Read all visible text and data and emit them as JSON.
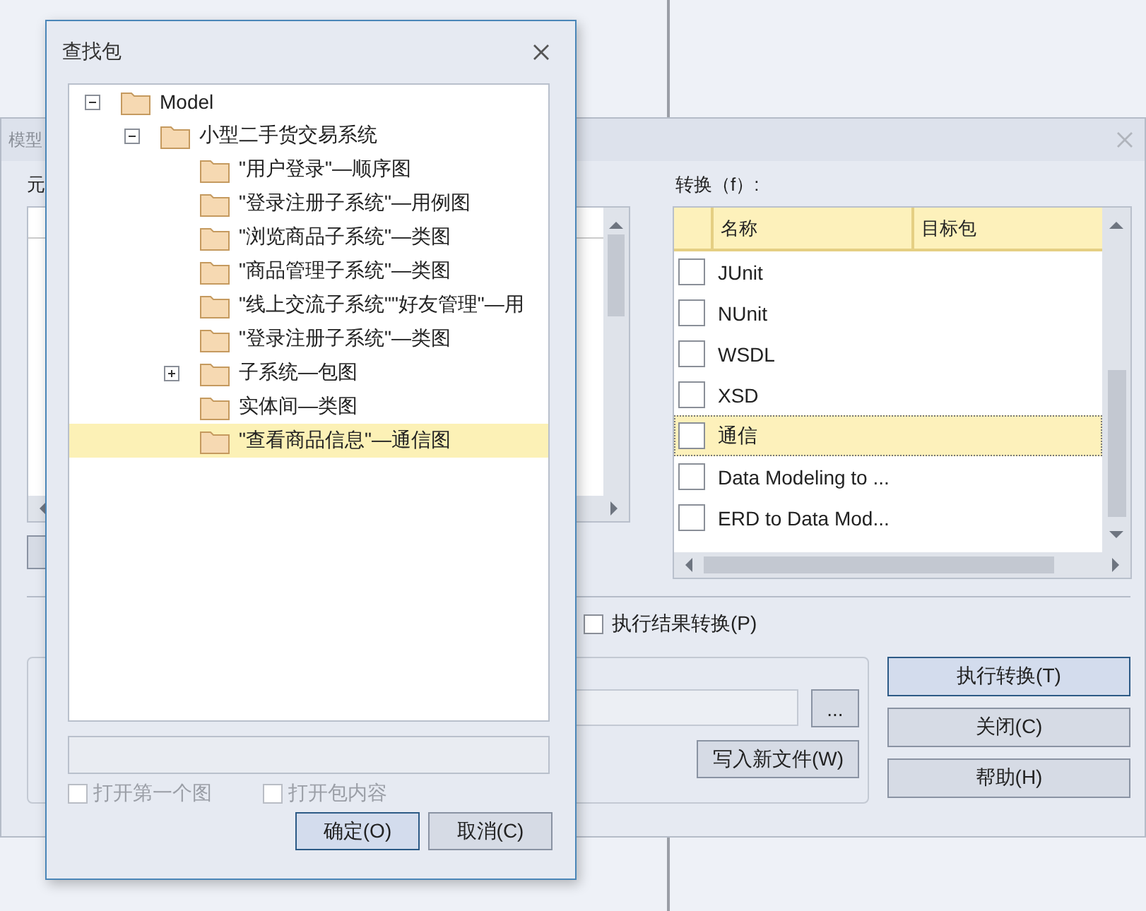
{
  "background_dialog": {
    "title": "模型",
    "element_label": "元",
    "transform_label": "转换（f）:",
    "transforms": {
      "columns": [
        "名称",
        "目标包"
      ],
      "rows": [
        {
          "name": "JUnit",
          "checked": false,
          "selected": false
        },
        {
          "name": "NUnit",
          "checked": false,
          "selected": false
        },
        {
          "name": "WSDL",
          "checked": false,
          "selected": false
        },
        {
          "name": "XSD",
          "checked": false,
          "selected": false
        },
        {
          "name": "通信",
          "checked": false,
          "selected": true
        },
        {
          "name": "Data Modeling to ...",
          "checked": false,
          "selected": false
        },
        {
          "name": "ERD to Data Mod...",
          "checked": false,
          "selected": false
        }
      ]
    },
    "execute_result_transform": {
      "label": "执行结果转换(P)",
      "checked": false
    },
    "browse_button": "...",
    "write_new_file_button": "写入新文件(W)",
    "buttons": [
      {
        "label": "执行转换(T)",
        "default": true
      },
      {
        "label": "关闭(C)",
        "default": false
      },
      {
        "label": "帮助(H)",
        "default": false
      }
    ]
  },
  "find_package_dialog": {
    "title": "查找包",
    "tree": [
      {
        "label": "Model",
        "expanded": true,
        "selected": false,
        "children": [
          {
            "label": "小型二手货交易系统",
            "expanded": true,
            "selected": false,
            "children": [
              {
                "label": "\"用户登录\"—顺序图",
                "selected": false
              },
              {
                "label": "\"登录注册子系统\"—用例图",
                "selected": false
              },
              {
                "label": "\"浏览商品子系统\"—类图",
                "selected": false
              },
              {
                "label": "\"商品管理子系统\"—类图",
                "selected": false
              },
              {
                "label": "\"线上交流子系统\"\"好友管理\"—用",
                "selected": false
              },
              {
                "label": "\"登录注册子系统\"—类图",
                "selected": false
              },
              {
                "label": "子系统—包图",
                "expanded": false,
                "selected": false
              },
              {
                "label": "实体间—类图",
                "selected": false
              },
              {
                "label": "\"查看商品信息\"—通信图",
                "selected": true
              }
            ]
          }
        ]
      }
    ],
    "options": [
      {
        "label": "打开第一个图",
        "checked": false,
        "disabled": true
      },
      {
        "label": "打开包内容",
        "checked": false,
        "disabled": true
      }
    ],
    "buttons": [
      {
        "label": "确定(O)",
        "default": true
      },
      {
        "label": "取消(C)",
        "default": false
      }
    ]
  }
}
